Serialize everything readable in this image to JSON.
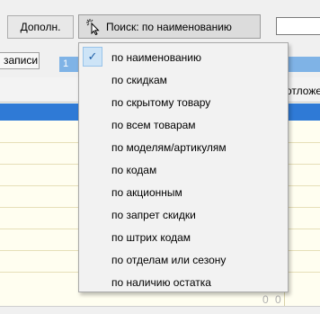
{
  "toolbar": {
    "more_label": "Дополн.",
    "search_label": "Поиск: по наименованию"
  },
  "tabs": {
    "records_label": "записи",
    "blue_tab_label": "1"
  },
  "grid": {
    "column_header": "отложе",
    "footer_values": [
      "0",
      "0"
    ]
  },
  "menu": {
    "items": [
      {
        "label": "по наименованию",
        "checked": true
      },
      {
        "label": "по скидкам",
        "checked": false
      },
      {
        "label": "по скрытому товару",
        "checked": false
      },
      {
        "label": "по всем товарам",
        "checked": false
      },
      {
        "label": "по моделям/артикулям",
        "checked": false
      },
      {
        "label": "по кодам",
        "checked": false
      },
      {
        "label": "по акционным",
        "checked": false
      },
      {
        "label": "по запрет скидки",
        "checked": false
      },
      {
        "label": "по штрих кодам",
        "checked": false
      },
      {
        "label": "по отделам или сезону",
        "checked": false
      },
      {
        "label": "по наличию остатка",
        "checked": false
      }
    ],
    "check_glyph": "✓"
  },
  "colors": {
    "selection": "#2f7ad6",
    "tab_blue": "#7fb3e6",
    "grid_bg": "#fffef0",
    "check_bg": "#cde4f7"
  }
}
